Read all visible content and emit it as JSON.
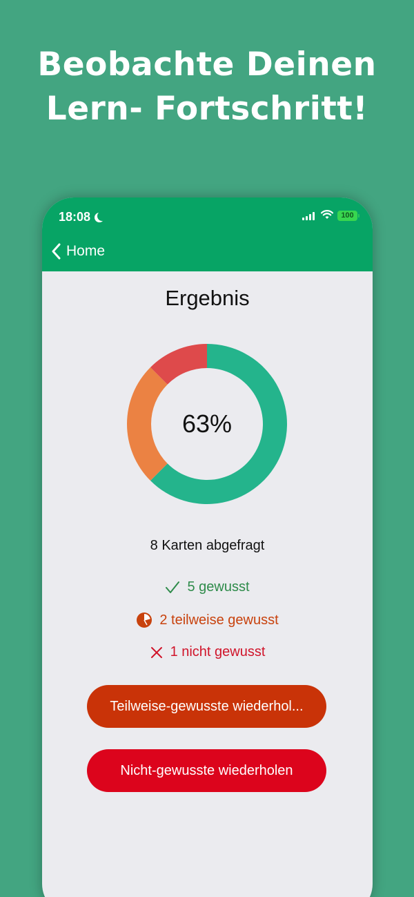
{
  "headline": {
    "line1": "Beobachte Deinen",
    "line2": "Lern- Fortschritt!"
  },
  "status_bar": {
    "time": "18:08",
    "battery": "100"
  },
  "nav": {
    "back_label": "Home"
  },
  "result": {
    "title": "Ergebnis",
    "percent_label": "63%",
    "cards_label": "8 Karten abgefragt",
    "known_label": "5 gewusst",
    "partial_label": "2 teilweise gewusst",
    "unknown_label": "1 nicht gewusst"
  },
  "buttons": {
    "repeat_partial": "Teilweise-gewusste wiederhol...",
    "repeat_unknown": "Nicht-gewusste wiederholen"
  },
  "colors": {
    "background": "#43a581",
    "bar": "#07a465",
    "known": "#24b48c",
    "partial": "#eb8243",
    "unknown": "#de4a4b",
    "button_partial": "#c93308",
    "button_unknown": "#dc041c"
  },
  "chart_data": {
    "type": "pie",
    "categories": [
      "gewusst",
      "teilweise gewusst",
      "nicht gewusst"
    ],
    "values": [
      5,
      2,
      1
    ],
    "colors": [
      "#24b48c",
      "#eb8243",
      "#de4a4b"
    ]
  }
}
